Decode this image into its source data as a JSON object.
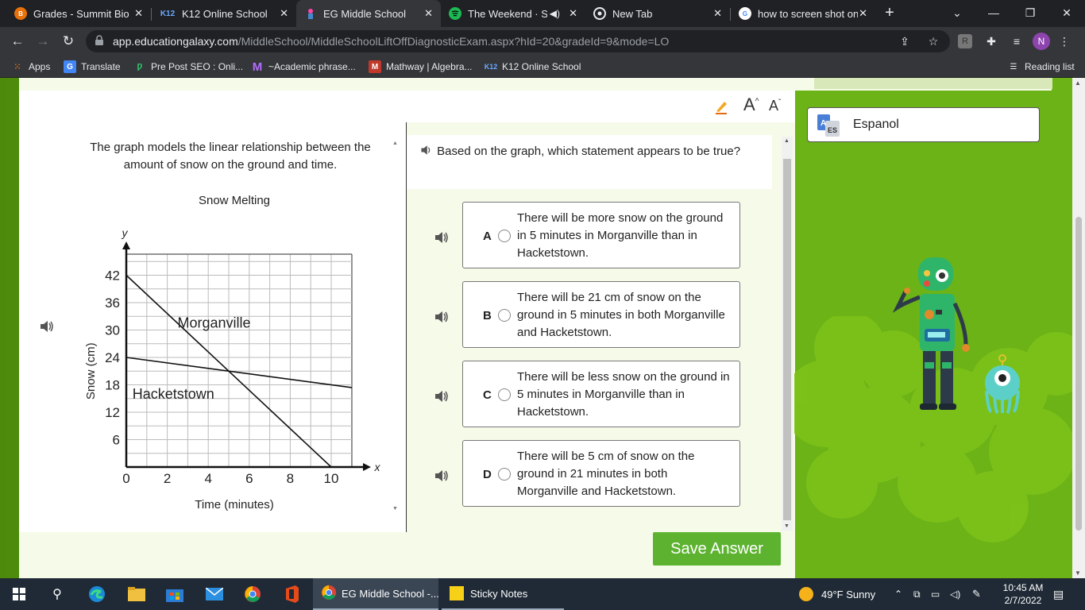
{
  "browser": {
    "tabs": [
      {
        "title": "Grades - Summit Biolo",
        "favicon_color": "#e8710a",
        "favicon_letter": "B"
      },
      {
        "title": "K12 Online School",
        "favicon_color": "#1a3a8a",
        "favicon_letter": "K12"
      },
      {
        "title": "EG Middle School",
        "favicon_color": "#3a6ad8",
        "favicon_letter": ""
      },
      {
        "title": "The Weekend · SZ",
        "favicon_color": "#1db954",
        "favicon_letter": ""
      },
      {
        "title": "New Tab",
        "favicon_color": "#e8eaed",
        "favicon_letter": ""
      },
      {
        "title": "how to screen shot on",
        "favicon_color": "#ffffff",
        "favicon_letter": "G"
      }
    ],
    "url_host": "app.educationgalaxy.com",
    "url_path": "/MiddleSchool/MiddleSchoolLiftOffDiagnosticExam.aspx?hId=20&gradeId=9&mode=LO",
    "profile_initial": "N",
    "bookmarks": [
      {
        "label": "Apps"
      },
      {
        "label": "Translate"
      },
      {
        "label": "Pre Post SEO : Onli..."
      },
      {
        "label": "~Academic phrase..."
      },
      {
        "label": "Mathway | Algebra..."
      },
      {
        "label": "K12 Online School"
      }
    ],
    "reading_list": "Reading list"
  },
  "tools": {
    "increase_font": "A",
    "decrease_font": "A"
  },
  "prompt": "The graph models the linear relationship between the amount of snow on the ground and time.",
  "chart_data": {
    "type": "line",
    "title": "Snow Melting",
    "xlabel": "Time (minutes)",
    "ylabel": "Snow (cm)",
    "x_axis_letter": "x",
    "y_axis_letter": "y",
    "xlim": [
      0,
      11
    ],
    "ylim": [
      0,
      46
    ],
    "x_ticks": [
      0,
      2,
      4,
      6,
      8,
      10
    ],
    "y_ticks": [
      6,
      12,
      18,
      24,
      30,
      36,
      42
    ],
    "series": [
      {
        "name": "Morganville",
        "x": [
          0,
          10
        ],
        "y": [
          42,
          0
        ]
      },
      {
        "name": "Hacketstown",
        "x": [
          0,
          11
        ],
        "y": [
          24,
          17.4
        ]
      }
    ]
  },
  "question": "Based on the graph, which statement appears to be true?",
  "choices": [
    {
      "letter": "A",
      "text": "There will be more snow on the ground in 5 minutes in Morganville than in Hacketstown."
    },
    {
      "letter": "B",
      "text": "There will be 21 cm of snow on the ground in 5 minutes in both Morganville and Hacketstown."
    },
    {
      "letter": "C",
      "text": "There will be less snow on the ground in 5 minutes in Morganville than in Hacketstown."
    },
    {
      "letter": "D",
      "text": "There will be 5 cm of snow on the ground in 21 minutes in both Morganville and Hacketstown."
    }
  ],
  "save_button": "Save Answer",
  "language_button": "Espanol",
  "language_icon_text": "A ES",
  "taskbar": {
    "apps": [
      {
        "label": "EG Middle School -..."
      },
      {
        "label": "Sticky Notes"
      }
    ],
    "weather": "49°F  Sunny",
    "time": "10:45 AM",
    "date": "2/7/2022"
  }
}
